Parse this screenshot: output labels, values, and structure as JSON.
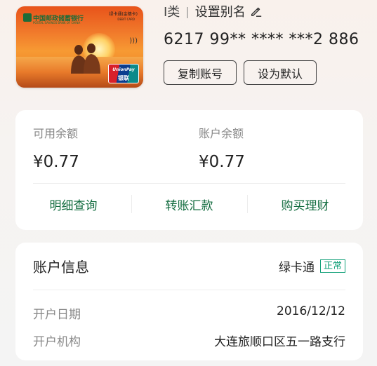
{
  "card": {
    "bank_name_cn": "中国邮政储蓄银行",
    "bank_name_en": "POSTAL SAVINGS BANK OF CHINA",
    "card_type": "绿卡通(金穗卡)",
    "debit_label": "DEBIT CARD",
    "network_en": "UnionPay",
    "network_cn": "银联"
  },
  "account": {
    "class": "I类",
    "set_alias": "设置别名",
    "number": "6217 99** **** ***2 886",
    "copy_button": "复制账号",
    "default_button": "设为默认"
  },
  "balance": {
    "available_label": "可用余额",
    "available_value": "¥0.77",
    "account_label": "账户余额",
    "account_value": "¥0.77",
    "actions": [
      "明细查询",
      "转账汇款",
      "购买理财"
    ]
  },
  "info": {
    "title": "账户信息",
    "card_kind": "绿卡通",
    "status": "正常",
    "rows": [
      {
        "key": "开户日期",
        "value": "2016/12/12"
      },
      {
        "key": "开户机构",
        "value": "大连旅顺口区五一路支行"
      }
    ]
  },
  "colors": {
    "accent_green": "#116b3e",
    "status_green": "#11a078"
  },
  "icons": [
    "edit-icon",
    "nfc-icon",
    "unionpay-logo"
  ]
}
